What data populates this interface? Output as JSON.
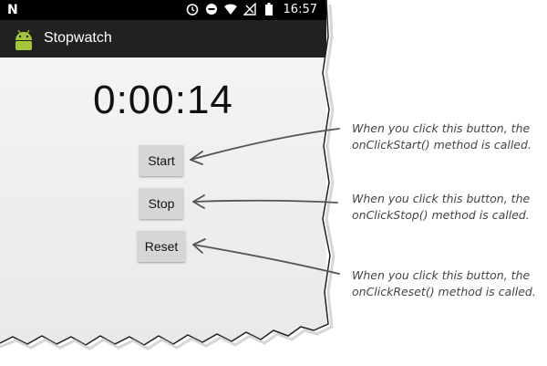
{
  "status_bar": {
    "time": "16:57",
    "left_icon": "N",
    "icons": [
      "alarm-icon",
      "do-not-disturb-icon",
      "wifi-icon",
      "no-signal-icon",
      "battery-icon"
    ]
  },
  "app_bar": {
    "title": "Stopwatch",
    "icon": "android-icon"
  },
  "stopwatch": {
    "time": "0:00:14"
  },
  "buttons": {
    "start": "Start",
    "stop": "Stop",
    "reset": "Reset"
  },
  "annotations": {
    "start": [
      "When you click this button, the",
      "onClickStart() method is called."
    ],
    "stop": [
      "When you click this button, the",
      "onClickStop() method is called."
    ],
    "reset": [
      "When you click this button, the",
      "onClickReset() method is called."
    ]
  },
  "colors": {
    "status_bar": "#000000",
    "app_bar": "#212121",
    "button": "#d6d6d6",
    "android_green": "#a4c639",
    "annotation_text": "#444444"
  }
}
